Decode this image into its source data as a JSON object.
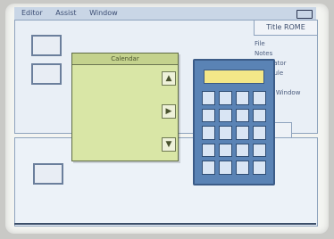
{
  "menubar": {
    "items": [
      "Editor",
      "Assist",
      "Window"
    ]
  },
  "window": {
    "title": "Title ROME"
  },
  "side_list": {
    "items": [
      "File",
      "Notes",
      "Calculator",
      "Schedule",
      "Clock",
      "Select Window",
      "Exit"
    ]
  },
  "calendar": {
    "title": "Calendar",
    "headers": [
      "",
      "",
      "",
      "",
      "",
      "",
      ""
    ],
    "rows": [
      [
        "",
        "",
        "",
        "",
        "",
        "",
        ""
      ],
      [
        "",
        "",
        "",
        "",
        "",
        "",
        ""
      ],
      [
        "",
        "",
        "",
        "",
        "",
        "",
        ""
      ],
      [
        "",
        "",
        "",
        "",
        "",
        "",
        ""
      ],
      [
        "",
        "",
        "",
        "",
        "",
        "",
        ""
      ],
      [
        "",
        "",
        "",
        "",
        "",
        "",
        ""
      ]
    ]
  },
  "calculator": {
    "display": ""
  }
}
